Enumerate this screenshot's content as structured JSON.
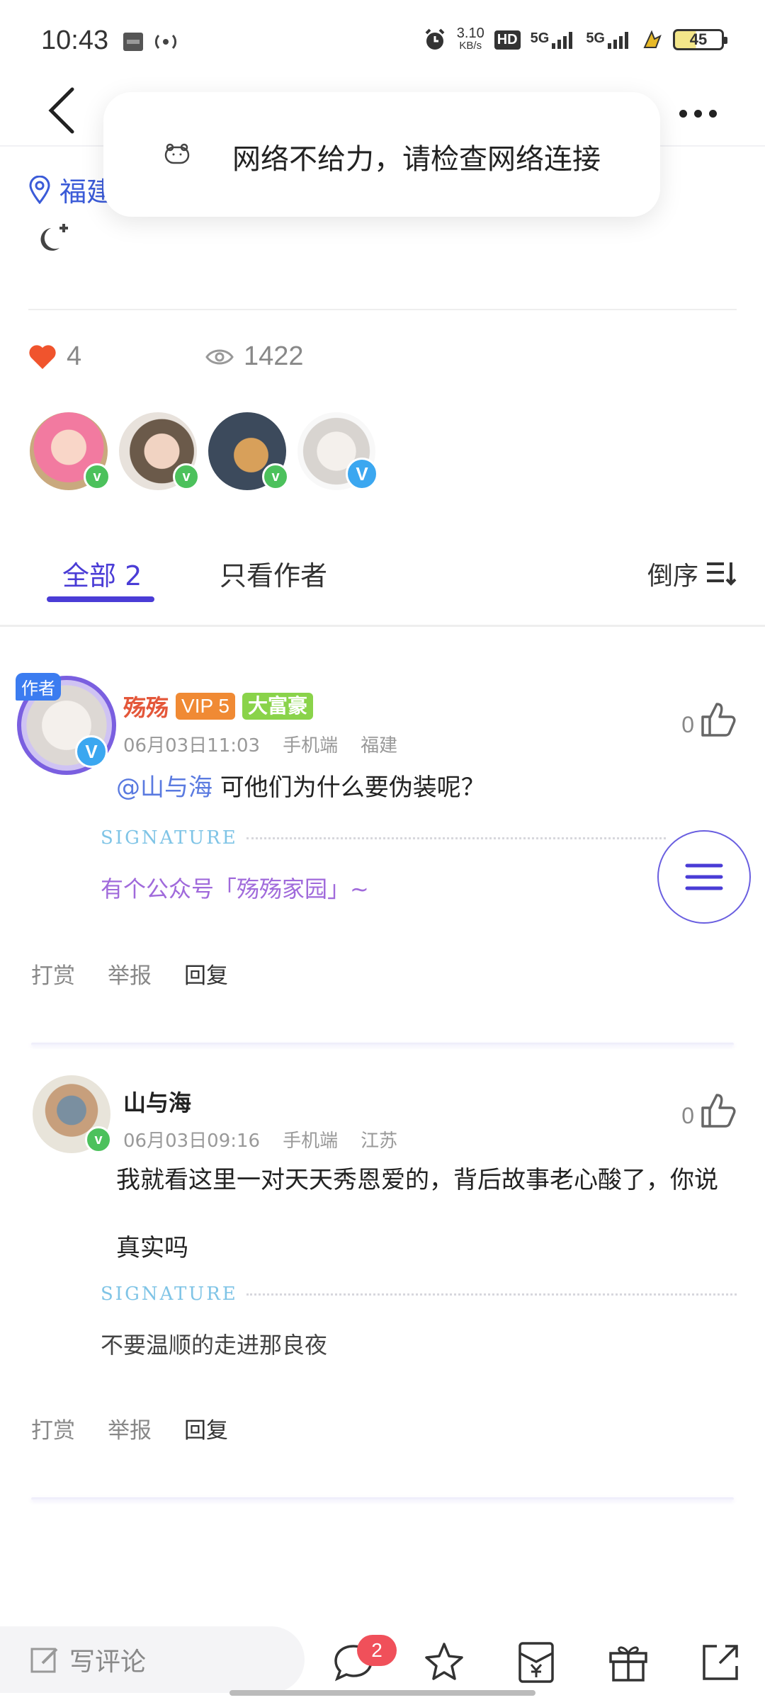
{
  "status_bar": {
    "time": "10:43",
    "network_speed": "3.10",
    "network_unit": "KB/s",
    "signal1": "5G",
    "signal2": "5G",
    "hd_label": "HD",
    "battery": "45"
  },
  "toast": {
    "message": "网络不给力，请检查网络连接"
  },
  "post": {
    "location": "福建"
  },
  "stats": {
    "likes": "4",
    "views": "1422"
  },
  "liked_users": [
    {
      "badge": "v"
    },
    {
      "badge": "v"
    },
    {
      "badge": "v"
    },
    {
      "badge": "V"
    }
  ],
  "tabs": {
    "all": "全部 2",
    "author_only": "只看作者",
    "sort": "倒序"
  },
  "comments": [
    {
      "author_tag": "作者",
      "name": "殇殇",
      "vip": "VIP 5",
      "rich": "大富豪",
      "date": "06月03日11:03",
      "device": "手机端",
      "region": "福建",
      "likes": "0",
      "mention": "@山与海",
      "text": " 可他们为什么要伪装呢？",
      "signature_label": "SIGNATURE",
      "signature": "有个公众号「殇殇家园」~",
      "actions": {
        "tip": "打赏",
        "report": "举报",
        "reply": "回复"
      }
    },
    {
      "name": "山与海",
      "date": "06月03日09:16",
      "device": "手机端",
      "region": "江苏",
      "likes": "0",
      "text": "我就看这里一对天天秀恩爱的，背后故事老心酸了，你说真实吗",
      "signature_label": "SIGNATURE",
      "signature": "不要温顺的走进那良夜",
      "actions": {
        "tip": "打赏",
        "report": "举报",
        "reply": "回复"
      }
    }
  ],
  "bottom_bar": {
    "comment_placeholder": "写评论",
    "comment_count": "2"
  },
  "colors": {
    "accent": "#4a3cd6",
    "like_red": "#f0542d",
    "mention_blue": "#5a7ae0",
    "signature_purple": "#a06adb"
  }
}
